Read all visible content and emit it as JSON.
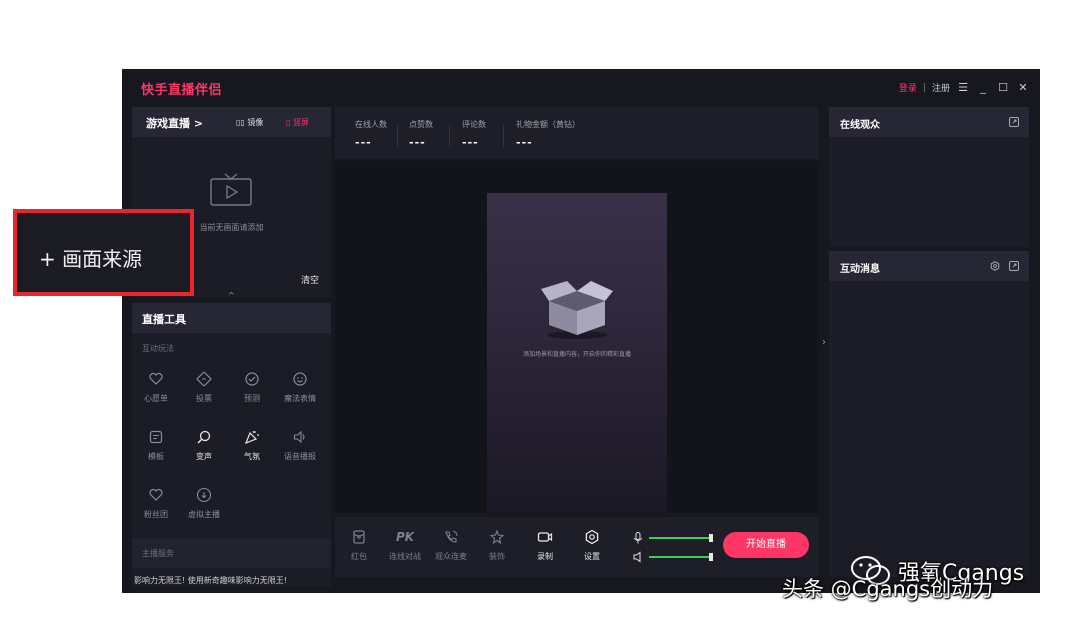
{
  "window": {
    "title": "快手直播伴侣",
    "login": "登录",
    "separator": "|",
    "register": "注册",
    "menu_glyph": "☰",
    "minimize_glyph": "_",
    "maximize_glyph": "☐",
    "close_glyph": "✕"
  },
  "scene_panel": {
    "title": "游戏直播 >",
    "mirror_label": "镜像",
    "vertical_label": "竖屏",
    "empty_text": "当前无画面请添加",
    "clear_label": "清空",
    "collapse_glyph": "^"
  },
  "tools_panel": {
    "title": "直播工具",
    "interactive_section": "互动玩法",
    "items": [
      {
        "label": "心愿单",
        "icon": "heart-badge-icon"
      },
      {
        "label": "投票",
        "icon": "ticket-icon"
      },
      {
        "label": "预测",
        "icon": "check-circle-icon"
      },
      {
        "label": "魔法表情",
        "icon": "smile-icon"
      },
      {
        "label": "模板",
        "icon": "template-icon"
      },
      {
        "label": "变声",
        "icon": "voice-change-icon"
      },
      {
        "label": "气氛",
        "icon": "party-popper-icon"
      },
      {
        "label": "语音播报",
        "icon": "speaker-icon"
      },
      {
        "label": "粉丝团",
        "icon": "fan-club-icon"
      },
      {
        "label": "虚拟主播",
        "icon": "virtual-host-icon"
      }
    ],
    "service_section": "主播服务",
    "cut_text": "影响力无限王!      使用新奇趣味影响力无限王!"
  },
  "stats": [
    {
      "label": "在线人数",
      "value": "---"
    },
    {
      "label": "点赞数",
      "value": "---"
    },
    {
      "label": "评论数",
      "value": "---"
    },
    {
      "label": "礼物金额（黄钻）",
      "value": "---"
    }
  ],
  "preview": {
    "hint": "添加场景和直播内容，开启你的精彩直播"
  },
  "bottom_tools": [
    {
      "label": "红包",
      "icon": "red-packet-icon"
    },
    {
      "label": "连线对战",
      "icon": "pk-icon"
    },
    {
      "label": "观众连麦",
      "icon": "phone-call-icon"
    },
    {
      "label": "装饰",
      "icon": "decoration-icon"
    },
    {
      "label": "录制",
      "icon": "record-icon"
    },
    {
      "label": "设置",
      "icon": "settings-icon"
    }
  ],
  "bottom_pk_text": "PK",
  "audio": {
    "mic_level": 0.97,
    "speaker_level": 0.97,
    "level_color": "#3bd14c"
  },
  "go_live_label": "开始直播",
  "right": {
    "viewers_title": "在线观众",
    "messages_title": "互动消息"
  },
  "callout": {
    "text": "+ 画面来源",
    "border_color": "#e8262e"
  },
  "watermark": {
    "line1": "强氧Cgangs",
    "line2": "头条 @Cgangs创动力"
  },
  "colors": {
    "brand": "#fe3666",
    "background": "#17171f",
    "panel": "#1c1c26"
  }
}
